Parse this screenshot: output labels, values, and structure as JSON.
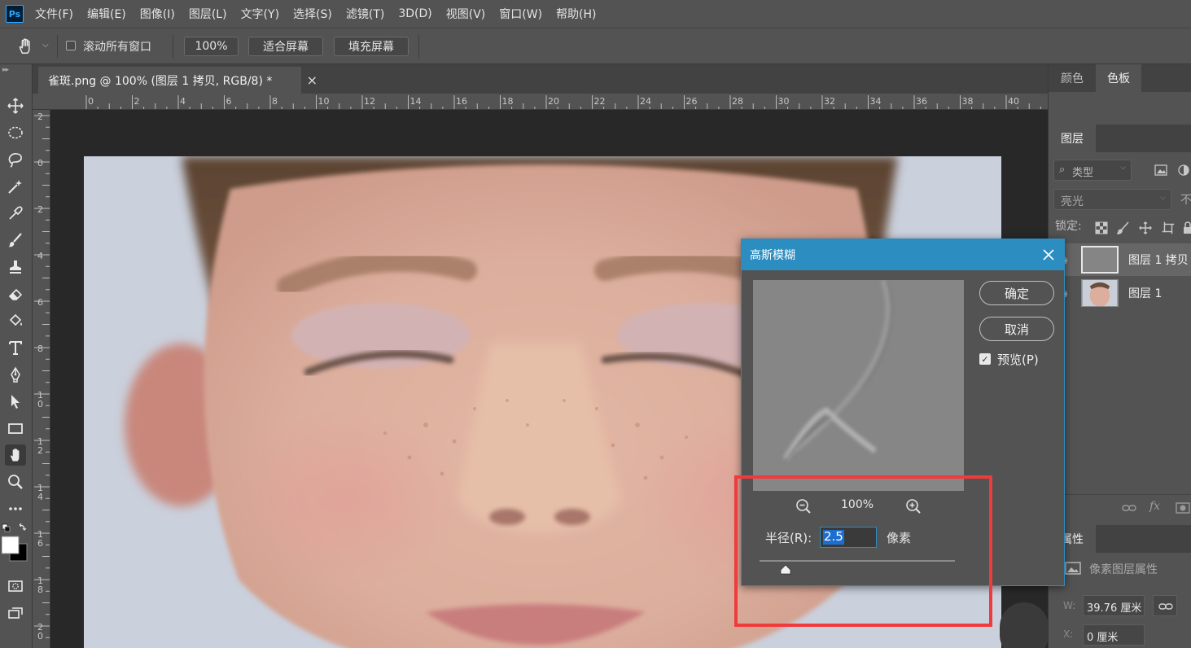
{
  "app": {
    "logo": "Ps"
  },
  "menu": [
    "文件(F)",
    "编辑(E)",
    "图像(I)",
    "图层(L)",
    "文字(Y)",
    "选择(S)",
    "滤镜(T)",
    "3D(D)",
    "视图(V)",
    "窗口(W)",
    "帮助(H)"
  ],
  "options": {
    "scroll_all_label": "滚动所有窗口",
    "scroll_all_checked": false,
    "zoom_value": "100%",
    "fit_screen": "适合屏幕",
    "fill_screen": "填充屏幕"
  },
  "document": {
    "tab_title": "雀斑.png @ 100% (图层 1 拷贝, RGB/8) *",
    "close": "×"
  },
  "rulers": {
    "top": [
      "0",
      "2",
      "4",
      "6",
      "8",
      "10",
      "12",
      "14",
      "16",
      "18",
      "20",
      "22",
      "24",
      "26",
      "28",
      "30",
      "32",
      "34",
      "36",
      "38",
      "40"
    ],
    "left": [
      "2",
      "0",
      "2",
      "4",
      "6",
      "8",
      "10",
      "12",
      "14",
      "16",
      "18",
      "20"
    ]
  },
  "panels": {
    "color_tab": "颜色",
    "swatches_tab": "色板",
    "layers_tab": "图层",
    "filter_kind": "类型",
    "blend_mode": "亮光",
    "opacity_partial": "不",
    "lock_label": "锁定:",
    "layers": [
      {
        "name": "图层 1 拷贝",
        "selected": true
      },
      {
        "name": "图层 1",
        "selected": false
      }
    ],
    "properties_tab": "属性",
    "pixel_layer_props": "像素图层属性",
    "w_label": "W:",
    "w_value": "39.76 厘米",
    "x_label": "X:",
    "x_value": "0 厘米"
  },
  "dialog": {
    "title": "高斯模糊",
    "ok": "确定",
    "cancel": "取消",
    "preview_label": "预览(P)",
    "preview_checked": true,
    "zoom_level": "100%",
    "radius_label": "半径(R):",
    "radius_value": "2.5",
    "radius_unit": "像素"
  },
  "colors": {
    "accent": "#2c8dc1",
    "highlight": "#ef3b3b",
    "panel_bg": "#535353"
  }
}
